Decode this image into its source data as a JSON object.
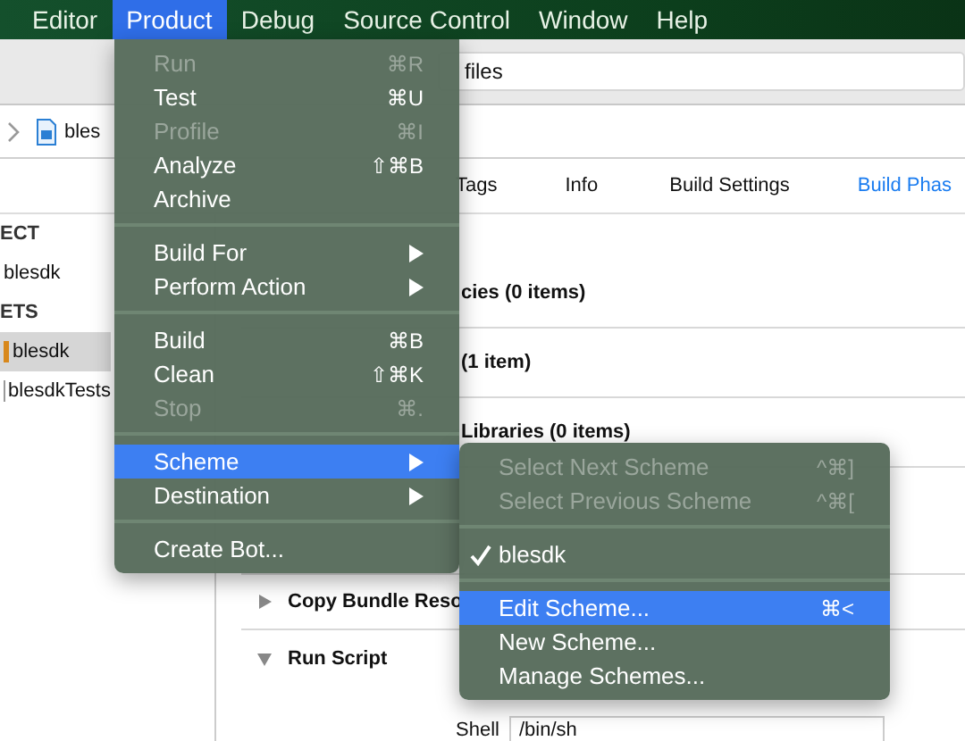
{
  "menubar": [
    {
      "label": "Editor",
      "selected": false
    },
    {
      "label": "Product",
      "selected": true
    },
    {
      "label": "Debug",
      "selected": false
    },
    {
      "label": "Source Control",
      "selected": false
    },
    {
      "label": "Window",
      "selected": false
    },
    {
      "label": "Help",
      "selected": false
    }
  ],
  "toolbar": {
    "search_text": "files"
  },
  "jump_bar": {
    "file": "bles"
  },
  "tabs": [
    {
      "label": "Tags",
      "selected": false
    },
    {
      "label": "Info",
      "selected": false
    },
    {
      "label": "Build Settings",
      "selected": false
    },
    {
      "label": "Build Phas",
      "selected": true
    }
  ],
  "sidebar": [
    {
      "kind": "header",
      "label": "ECT",
      "selected": false
    },
    {
      "kind": "project",
      "label": "blesdk",
      "selected": false
    },
    {
      "kind": "header",
      "label": "ETS",
      "selected": false
    },
    {
      "kind": "app",
      "label": "blesdk",
      "selected": true
    },
    {
      "kind": "test",
      "label": "blesdkTests",
      "selected": false
    }
  ],
  "phases": [
    {
      "kind": "partial",
      "title": "cies (0 items)"
    },
    {
      "kind": "partial",
      "title": "(1 item)"
    },
    {
      "kind": "partial",
      "title": "Libraries (0 items)"
    },
    {
      "kind": "empty"
    },
    {
      "kind": "collapsed",
      "title": "Copy Bundle Reso"
    },
    {
      "kind": "expanded",
      "title": "Run Script"
    }
  ],
  "shell": {
    "label": "Shell",
    "value": "/bin/sh"
  },
  "menu": [
    {
      "kind": "item",
      "label": "Run",
      "shortcut": "⌘R",
      "disabled": true,
      "selected": false,
      "submenu": false
    },
    {
      "kind": "item",
      "label": "Test",
      "shortcut": "⌘U",
      "disabled": false,
      "selected": false,
      "submenu": false
    },
    {
      "kind": "item",
      "label": "Profile",
      "shortcut": "⌘I",
      "disabled": true,
      "selected": false,
      "submenu": false
    },
    {
      "kind": "item",
      "label": "Analyze",
      "shortcut": "⇧⌘B",
      "disabled": false,
      "selected": false,
      "submenu": false
    },
    {
      "kind": "item",
      "label": "Archive",
      "disabled": false,
      "selected": false,
      "submenu": false
    },
    {
      "kind": "separator"
    },
    {
      "kind": "item",
      "label": "Build For",
      "disabled": false,
      "selected": false,
      "submenu": true
    },
    {
      "kind": "item",
      "label": "Perform Action",
      "disabled": false,
      "selected": false,
      "submenu": true
    },
    {
      "kind": "separator"
    },
    {
      "kind": "item",
      "label": "Build",
      "shortcut": "⌘B",
      "disabled": false,
      "selected": false,
      "submenu": false
    },
    {
      "kind": "item",
      "label": "Clean",
      "shortcut": "⇧⌘K",
      "disabled": false,
      "selected": false,
      "submenu": false
    },
    {
      "kind": "item",
      "label": "Stop",
      "shortcut": "⌘.",
      "disabled": true,
      "selected": false,
      "submenu": false
    },
    {
      "kind": "separator"
    },
    {
      "kind": "item",
      "label": "Scheme",
      "disabled": false,
      "selected": true,
      "submenu": true
    },
    {
      "kind": "item",
      "label": "Destination",
      "disabled": false,
      "selected": false,
      "submenu": true
    },
    {
      "kind": "separator"
    },
    {
      "kind": "item",
      "label": "Create Bot...",
      "disabled": false,
      "selected": false,
      "submenu": false
    }
  ],
  "submenu": [
    {
      "kind": "item",
      "label": "Select Next Scheme",
      "shortcut": "^⌘]",
      "disabled": true,
      "selected": false,
      "checked": false
    },
    {
      "kind": "item",
      "label": "Select Previous Scheme",
      "shortcut": "^⌘[",
      "disabled": true,
      "selected": false,
      "checked": false
    },
    {
      "kind": "separator"
    },
    {
      "kind": "item",
      "label": "blesdk",
      "disabled": false,
      "selected": false,
      "checked": true
    },
    {
      "kind": "separator"
    },
    {
      "kind": "item",
      "label": "Edit Scheme...",
      "shortcut": "⌘<",
      "disabled": false,
      "selected": true,
      "checked": false
    },
    {
      "kind": "item",
      "label": "New Scheme...",
      "disabled": false,
      "selected": false,
      "checked": false
    },
    {
      "kind": "item",
      "label": "Manage Schemes...",
      "disabled": false,
      "selected": false,
      "checked": false
    }
  ]
}
